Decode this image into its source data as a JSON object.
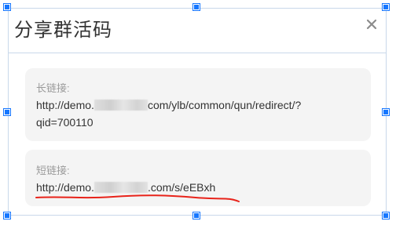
{
  "dialog": {
    "title": "分享群活码",
    "close_icon": "close-icon"
  },
  "long_link": {
    "label": "长链接:",
    "url_prefix": "http://demo.",
    "url_rest_line1": "com/ylb/common/qun/redirect/?",
    "url_line2": "qid=700110"
  },
  "short_link": {
    "label": "短链接:",
    "url_prefix": "http://demo.",
    "url_rest": ".com/s/eEBxh"
  },
  "colors": {
    "accent": "#1677ff",
    "annotation": "#e8231a",
    "card_bg": "#f4f4f4"
  }
}
